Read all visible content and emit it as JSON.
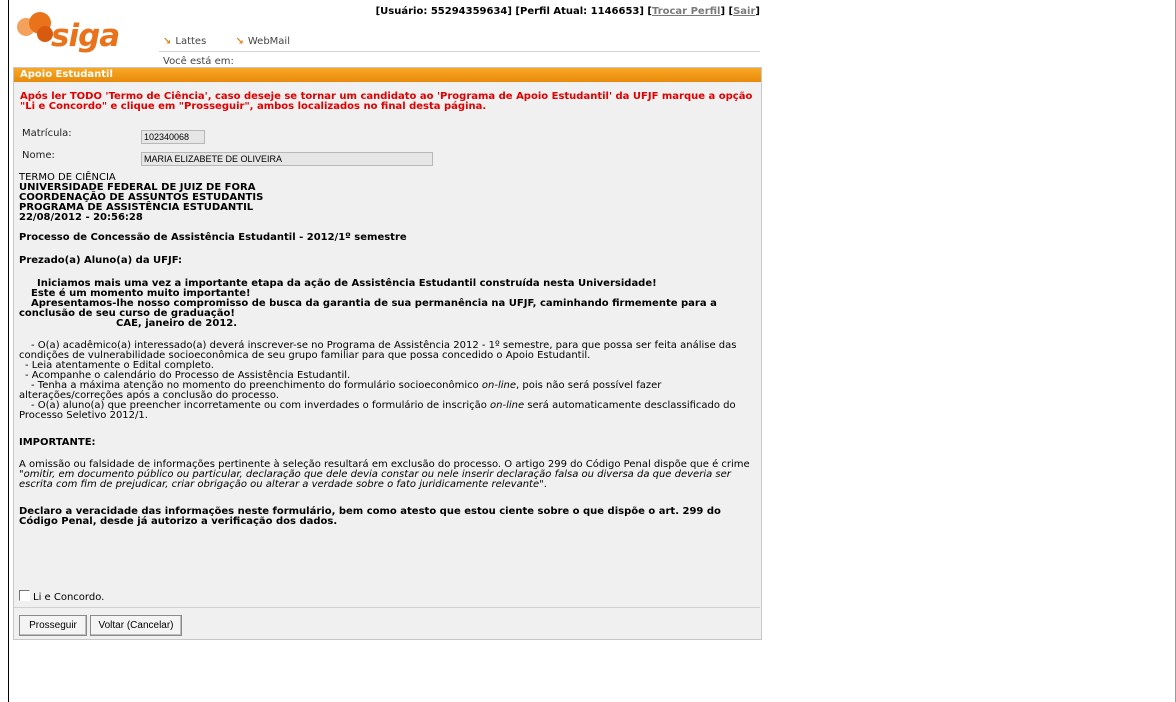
{
  "topbar": {
    "user_prefix": "[Usuário: 55294359634] [Perfil Atual: 1146653] [",
    "change_profile": "Trocar Perfil",
    "mid": "] [",
    "logout": "Sair",
    "suffix": "]"
  },
  "logo": {
    "text": "siga"
  },
  "nav": {
    "links": [
      {
        "label": "Lattes",
        "icon": "orange-arrow-icon"
      },
      {
        "label": "WebMail",
        "icon": "orange-arrow-icon"
      }
    ],
    "you_are_here": "Você está em:"
  },
  "panel": {
    "title": "Apoio Estudantil",
    "warning": "Após ler TODO 'Termo de Ciência', caso deseje se tornar um candidato ao 'Programa de Apoio Estudantil' da UFJF marque a opção \"Li e Concordo\" e clique em \"Prosseguir\", ambos localizados no final desta página."
  },
  "form": {
    "matricula_label": "Matrícula:",
    "matricula_value": "102340068",
    "nome_label": "Nome:",
    "nome_value": "MARIA ELIZABETE DE OLIVEIRA"
  },
  "term": {
    "title": "TERMO DE CIÊNCIA",
    "header_lines": [
      "UNIVERSIDADE FEDERAL DE JUIZ DE FORA",
      "COORDENAÇÃO DE ASSUNTOS ESTUDANTIS",
      "PROGRAMA DE ASSISTÊNCIA ESTUDANTIL",
      "22/08/2012 - 20:56:28"
    ],
    "process_title": "Processo de Concessão de Assistência Estudantil - 2012/1º semestre",
    "greeting": "Prezado(a) Aluno(a) da UFJF:",
    "intro_1": "Iniciamos mais uma vez a importante etapa da ação de Assistência Estudantil construída nesta Universidade!",
    "intro_2": "Este é um momento muito importante!",
    "intro_3": "Apresentamos-lhe nosso compromisso de busca da garantia de sua permanência na UFJF, caminhando firmemente para a conclusão de seu curso de graduação!",
    "signature": "CAE, janeiro de 2012.",
    "bullet_1": "- O(a) acadêmico(a) interessado(a) deverá inscrever-se no Programa de Assistência 2012 - 1º semestre, para que possa ser feita análise das condições de vulnerabilidade socioeconômica de seu grupo familiar para que possa concedido o Apoio Estudantil.",
    "bullet_2": "- Leia atentamente o Edital completo.",
    "bullet_3": "- Acompanhe o calendário do Processo de Assistência Estudantil.",
    "bullet_4_a": "- Tenha a máxima atenção no momento do preenchimento do formulário socioeconômico ",
    "bullet_4_em": "on-line",
    "bullet_4_b": ", pois não será possível fazer alterações/correções após a conclusão do processo.",
    "bullet_5_a": "- O(a) aluno(a) que preencher incorretamente ou com inverdades o formulário de inscrição ",
    "bullet_5_em": "on-line",
    "bullet_5_b": " será automaticamente desclassificado do Processo Seletivo 2012/1.",
    "important_title": "IMPORTANTE:",
    "important_a": "A omissão ou falsidade de informações pertinente à seleção resultará em exclusão do processo. O artigo 299 do Código Penal dispõe que é crime ",
    "important_quote": "\"omitir, em documento público ou particular, declaração que dele devia constar ou nele inserir declaração falsa ou diversa da que deveria ser escrita com fim de prejudicar, criar obrigação ou alterar a verdade sobre o fato juridicamente relevante\"",
    "important_b": ".",
    "declaration": "Declaro a veracidade das informações neste formulário, bem como atesto que estou ciente sobre o que dispõe o art. 299 do Código Penal, desde já autorizo a verificação dos dados."
  },
  "agree": {
    "label": "Li e Concordo.",
    "checked": false
  },
  "buttons": {
    "proceed": "Prosseguir",
    "back": "Voltar (Cancelar)"
  },
  "colors": {
    "header_orange": "#f39c12",
    "warning_red": "#e00000",
    "link_gray": "#7a7a7a"
  }
}
